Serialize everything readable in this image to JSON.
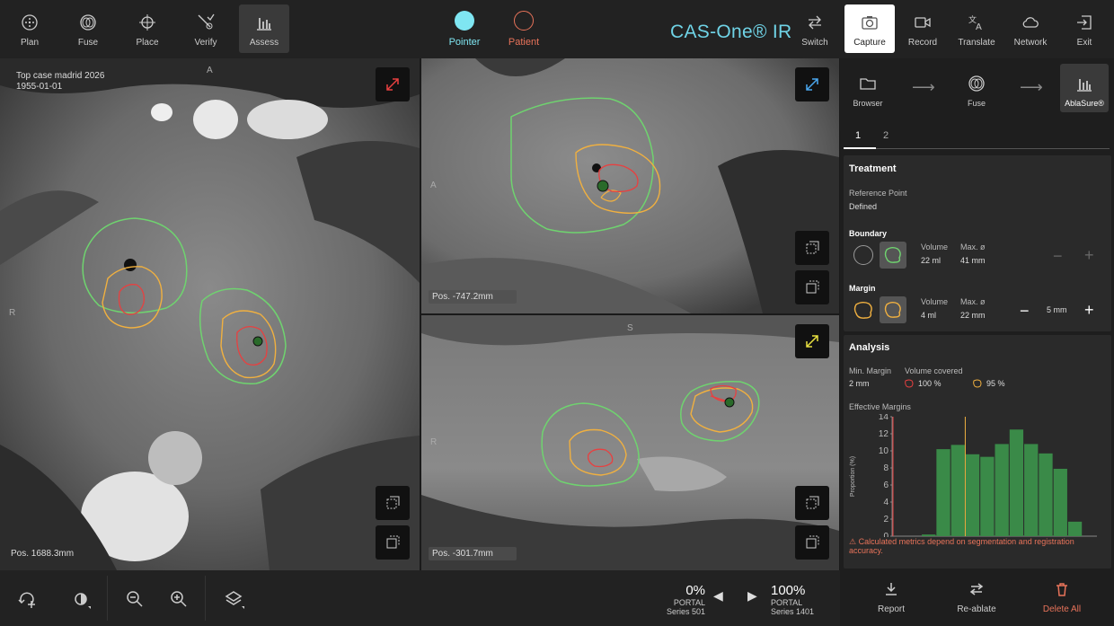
{
  "toolbar": {
    "left": [
      {
        "label": "Plan",
        "icon": "plan-icon"
      },
      {
        "label": "Fuse",
        "icon": "fuse-icon"
      },
      {
        "label": "Place",
        "icon": "place-icon"
      },
      {
        "label": "Verify",
        "icon": "verify-icon"
      },
      {
        "label": "Assess",
        "icon": "assess-icon"
      }
    ],
    "pointer_label": "Pointer",
    "patient_label": "Patient",
    "brand": "CAS-One® IR",
    "right": [
      {
        "label": "Switch",
        "icon": "switch-icon"
      },
      {
        "label": "Capture",
        "icon": "camera-icon"
      },
      {
        "label": "Record",
        "icon": "record-icon"
      },
      {
        "label": "Translate",
        "icon": "translate-icon"
      },
      {
        "label": "Network",
        "icon": "cloud-icon"
      },
      {
        "label": "Exit",
        "icon": "exit-icon"
      }
    ]
  },
  "colors": {
    "pointer": "#7fe6f2",
    "patient": "#e8735a",
    "green": "#6fd36f",
    "orange": "#f0b040",
    "red": "#e84040",
    "bar": "#3a8a48"
  },
  "views": {
    "left": {
      "case": "Top case madrid 2026",
      "date": "1955-01-01",
      "pos": "Pos. 1688.3mm",
      "orient_top": "A",
      "orient_left": "R"
    },
    "top_right": {
      "pos": "Pos. -747.2mm",
      "orient_left": "A"
    },
    "bottom_right": {
      "pos": "Pos. -301.7mm",
      "orient_top": "S",
      "orient_left": "R"
    }
  },
  "workflow": {
    "items": [
      "Browser",
      "Fuse",
      "AblaSure®"
    ]
  },
  "tabs": [
    "1",
    "2"
  ],
  "treatment": {
    "title": "Treatment",
    "ref_label": "Reference Point",
    "ref_value": "Defined",
    "boundary": {
      "title": "Boundary",
      "volume_label": "Volume",
      "volume": "22 ml",
      "max_label": "Max. ø",
      "max": "41 mm"
    },
    "margin": {
      "title": "Margin",
      "volume_label": "Volume",
      "volume": "4 ml",
      "max_label": "Max. ø",
      "max": "22 mm",
      "step": "5 mm"
    }
  },
  "analysis": {
    "title": "Analysis",
    "min_margin_label": "Min. Margin",
    "min_margin": "2 mm",
    "covered_label": "Volume covered",
    "covered_red": "100 %",
    "covered_orange": "95 %",
    "effective_label": "Effective Margins",
    "warning": "Calculated metrics depend on segmentation and registration accuracy."
  },
  "chart_data": {
    "type": "bar",
    "ylabel": "Proportion (%)",
    "ylim": [
      0,
      14
    ],
    "xlim": [
      0,
      14
    ],
    "yticks": [
      0,
      2,
      4,
      6,
      8,
      10,
      12,
      14
    ],
    "xticks": [
      0,
      2,
      4,
      6,
      8,
      10,
      12,
      14
    ],
    "bins_start": 2,
    "bin_width": 1,
    "values": [
      0.2,
      10.2,
      10.7,
      9.6,
      9.3,
      10.8,
      12.5,
      10.8,
      9.7,
      7.9,
      1.7
    ],
    "min_margin_line": 0,
    "margin_line": 5
  },
  "bottom": {
    "left_series": {
      "pct": "0%",
      "name": "PORTAL",
      "series": "Series 501"
    },
    "right_series": {
      "pct": "100%",
      "name": "PORTAL",
      "series": "Series 1401"
    },
    "report": "Report",
    "reablate": "Re-ablate",
    "delete": "Delete All"
  }
}
